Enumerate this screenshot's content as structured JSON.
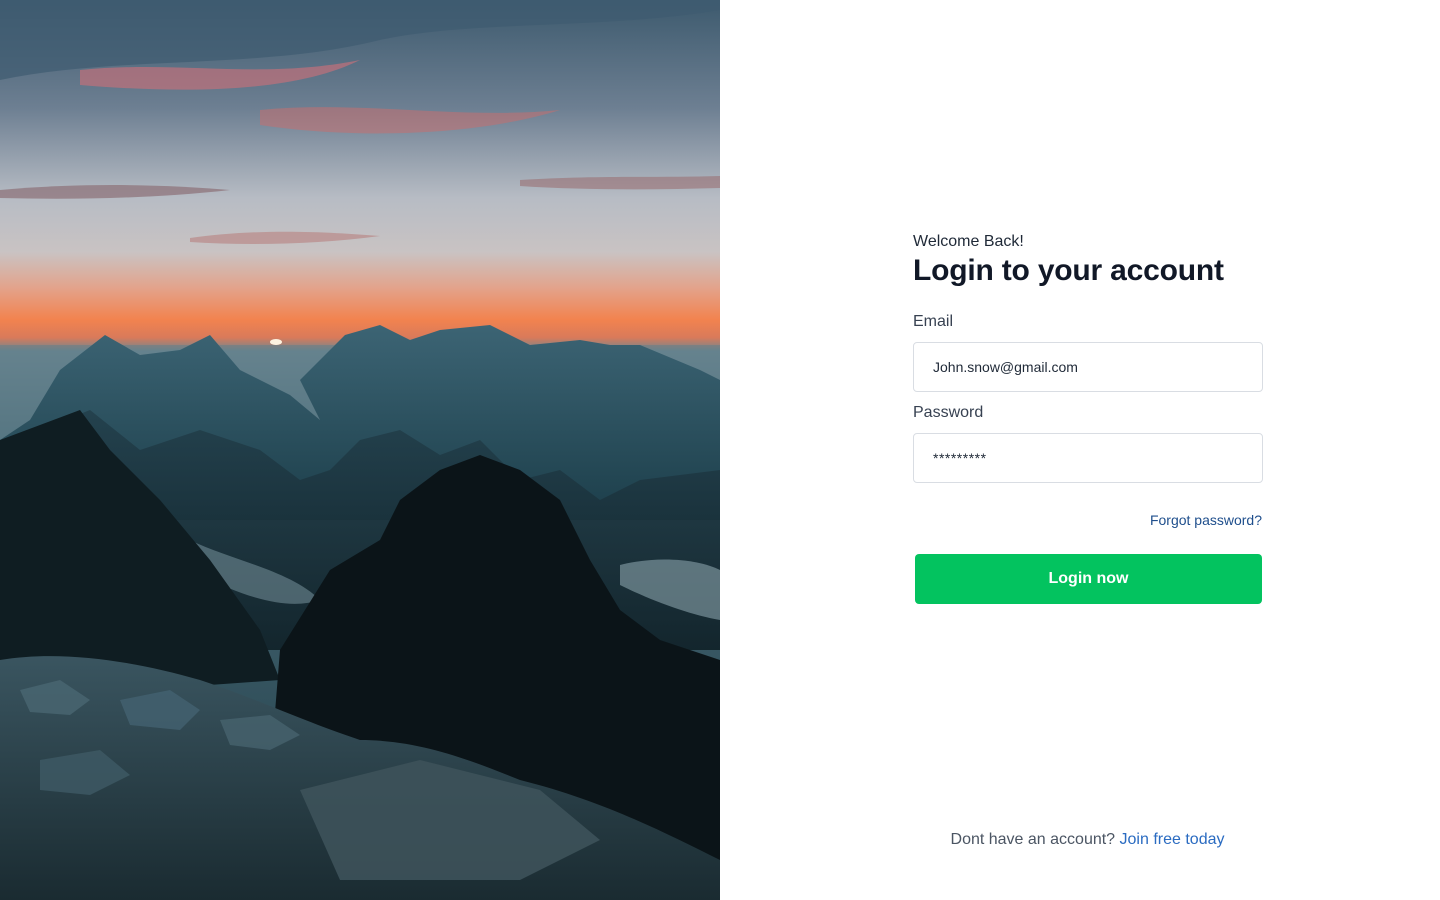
{
  "hero": {
    "image_name": "mountain-sunset-photo"
  },
  "login": {
    "welcome": "Welcome Back!",
    "title": "Login to your account",
    "email_label": "Email",
    "email_value": "John.snow@gmail.com",
    "password_label": "Password",
    "password_value": "*********",
    "forgot_link": "Forgot password?",
    "submit_label": "Login now"
  },
  "footer": {
    "prompt": "Dont have an account?",
    "signup_link": "Join free today"
  },
  "colors": {
    "accent": "#03c35f",
    "link": "#2a6bc1",
    "heading": "#111827"
  }
}
